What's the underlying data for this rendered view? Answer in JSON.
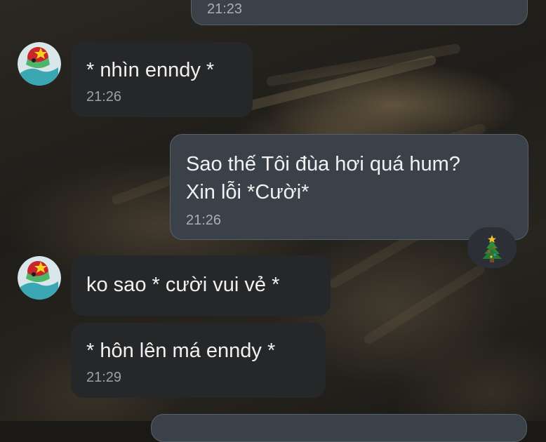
{
  "conversation": {
    "messages": [
      {
        "id": "m0",
        "direction": "outgoing",
        "text": "",
        "time": "21:23"
      },
      {
        "id": "m1",
        "direction": "incoming",
        "text": "* nhìn enndy *",
        "time": "21:26"
      },
      {
        "id": "m2",
        "direction": "outgoing",
        "text": "Sao thế Tôi đùa hơi quá hum?\nXin lỗi *Cười*",
        "time": "21:26"
      },
      {
        "id": "m3",
        "direction": "incoming",
        "text": "ko sao * cười vui vẻ *",
        "time": ""
      },
      {
        "id": "m4",
        "direction": "incoming",
        "text": "* hôn lên má enndy *",
        "time": "21:29"
      }
    ],
    "reaction": {
      "icon": "christmas-tree-icon"
    },
    "avatar": {
      "icon": "green-bird-character-avatar"
    },
    "colors": {
      "incoming_bubble": "#262729",
      "outgoing_bubble": "#3b4149",
      "outgoing_border": "#56606b",
      "text": "#f1f1f1",
      "time": "#9aa0a6"
    }
  }
}
